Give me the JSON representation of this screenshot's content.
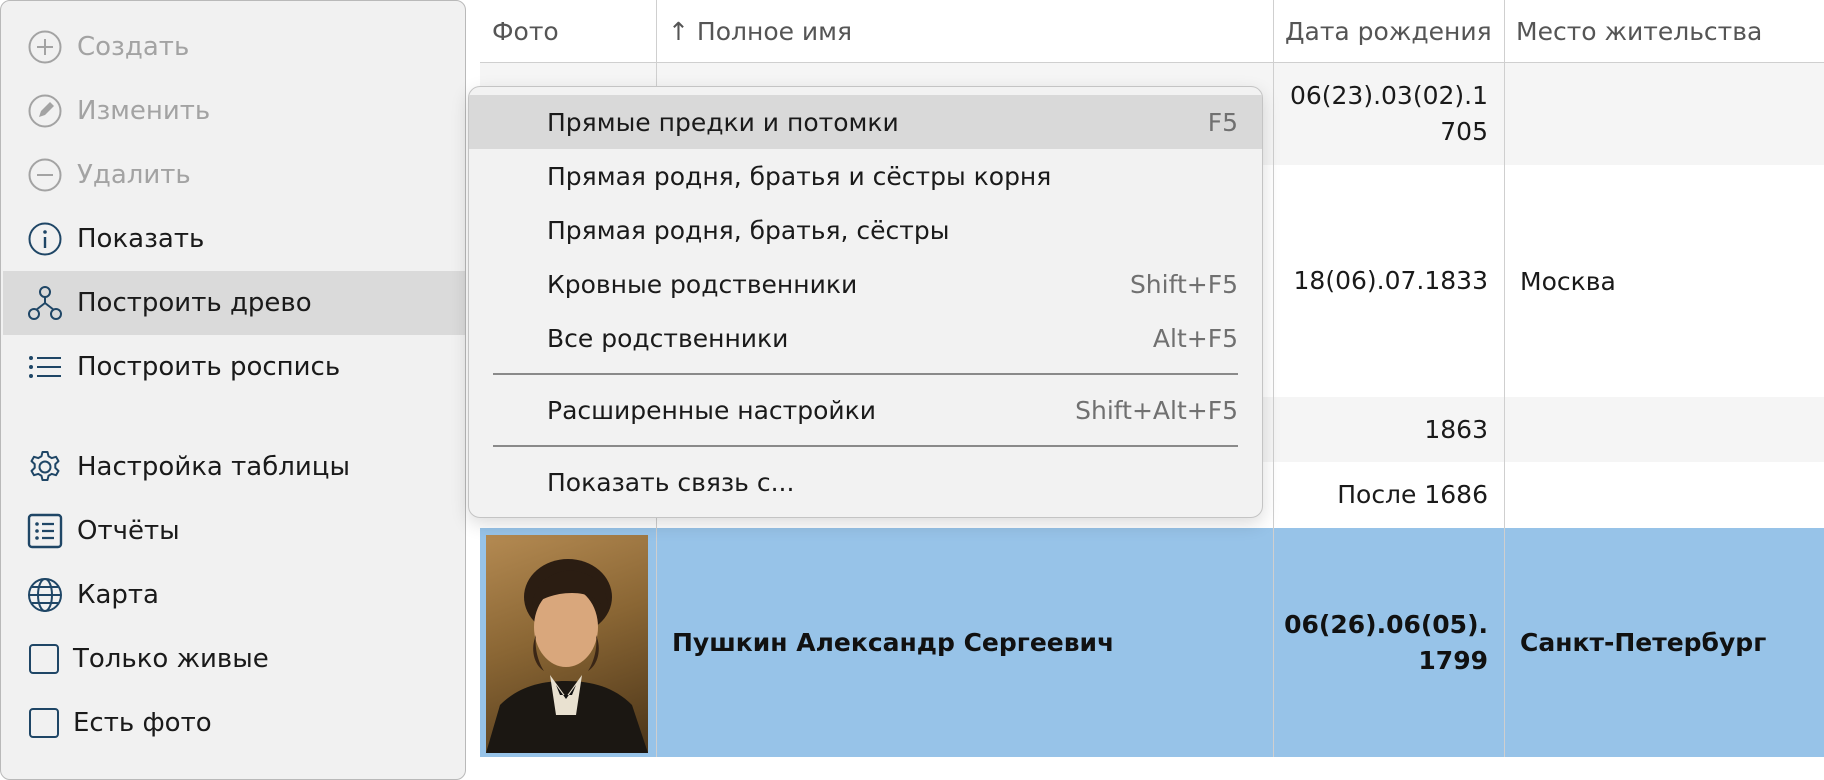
{
  "sidebar": {
    "items": [
      {
        "label": "Создать",
        "icon": "plus-circle-icon",
        "state": "disabled"
      },
      {
        "label": "Изменить",
        "icon": "pencil-circle-icon",
        "state": "disabled"
      },
      {
        "label": "Удалить",
        "icon": "minus-circle-icon",
        "state": "disabled"
      },
      {
        "label": "Показать",
        "icon": "info-circle-icon",
        "state": "normal"
      },
      {
        "label": "Построить древо",
        "icon": "family-tree-icon",
        "state": "active"
      },
      {
        "label": "Построить роспись",
        "icon": "bullet-list-icon",
        "state": "normal"
      },
      {
        "label": "Настройка таблицы",
        "icon": "gear-icon",
        "state": "normal"
      },
      {
        "label": "Отчёты",
        "icon": "report-list-icon",
        "state": "normal"
      },
      {
        "label": "Карта",
        "icon": "globe-icon",
        "state": "normal"
      }
    ],
    "checkboxes": [
      {
        "label": "Только живые",
        "checked": false
      },
      {
        "label": "Есть фото",
        "checked": false
      }
    ]
  },
  "table": {
    "columns": [
      "Фото",
      "↑ Полное имя",
      "Дата рождения",
      "Место жительства"
    ],
    "rows": [
      {
        "birth_date": "06(23).03(02).1\n705",
        "residence": ""
      },
      {
        "birth_date": "18(06).07.1833",
        "residence": "Москва"
      },
      {
        "birth_date": "1863",
        "residence": ""
      },
      {
        "birth_date": "После 1686",
        "residence": ""
      },
      {
        "name": "Пушкин Александр Сергеевич",
        "birth_date": "06(26).06(05).\n1799",
        "residence": "Санкт-Петербург",
        "selected": true,
        "has_photo": true
      }
    ]
  },
  "menu": {
    "items": [
      {
        "label": "Прямые предки и потомки",
        "shortcut": "F5",
        "highlighted": true
      },
      {
        "label": "Прямая родня, братья и сёстры корня",
        "shortcut": ""
      },
      {
        "label": "Прямая родня, братья, сёстры",
        "shortcut": ""
      },
      {
        "label": "Кровные родственники",
        "shortcut": "Shift+F5"
      },
      {
        "label": "Все родственники",
        "shortcut": "Alt+F5"
      },
      {
        "label": "Расширенные настройки",
        "shortcut": "Shift+Alt+F5"
      },
      {
        "label": "Показать связь с...",
        "shortcut": ""
      }
    ]
  },
  "colors": {
    "selection": "#97c3e8",
    "icon_active": "#1f4666",
    "icon_disabled": "#a3a3a3",
    "menu_highlight": "#d9d9d9"
  }
}
